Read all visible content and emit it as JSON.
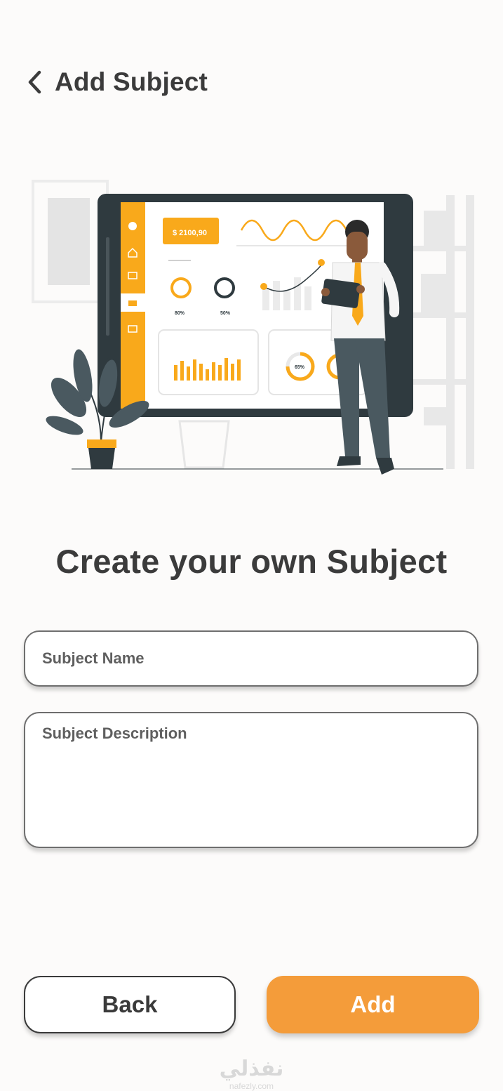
{
  "header": {
    "back_icon": "chevron-left-icon",
    "title": "Add Subject"
  },
  "illustration": {
    "name": "dashboard-presentation-illustration",
    "amount_label": "$ 2100,90",
    "ring_pct_1": "80%",
    "ring_pct_2": "50%",
    "donut_label": "65%",
    "colors": {
      "accent": "#f9a91b",
      "dark": "#2f3a3f",
      "pants": "#4a5960",
      "skin": "#8a5a3b",
      "light_gray": "#e7e7e7"
    }
  },
  "form": {
    "title": "Create your own Subject",
    "subject_name": {
      "value": "",
      "placeholder": "Subject Name"
    },
    "subject_description": {
      "value": "",
      "placeholder": "Subject Description"
    }
  },
  "buttons": {
    "back_label": "Back",
    "add_label": "Add"
  },
  "watermark": {
    "arabic": "نفذلي",
    "latin": "nafezly.com"
  },
  "colors": {
    "background": "#fcfbfa",
    "primary": "#f49c3a",
    "text": "#3b3b3b"
  }
}
